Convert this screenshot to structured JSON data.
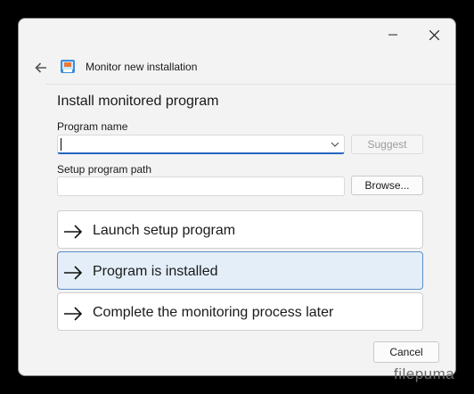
{
  "window": {
    "title": "Monitor new installation"
  },
  "heading": "Install monitored program",
  "program_name": {
    "label": "Program name",
    "value": "",
    "suggest_label": "Suggest"
  },
  "setup_path": {
    "label": "Setup program path",
    "value": "",
    "browse_label": "Browse..."
  },
  "commands": [
    {
      "label": "Launch setup program"
    },
    {
      "label": "Program is installed"
    },
    {
      "label": "Complete the monitoring process later"
    }
  ],
  "cancel_label": "Cancel",
  "watermark": "filepuma"
}
